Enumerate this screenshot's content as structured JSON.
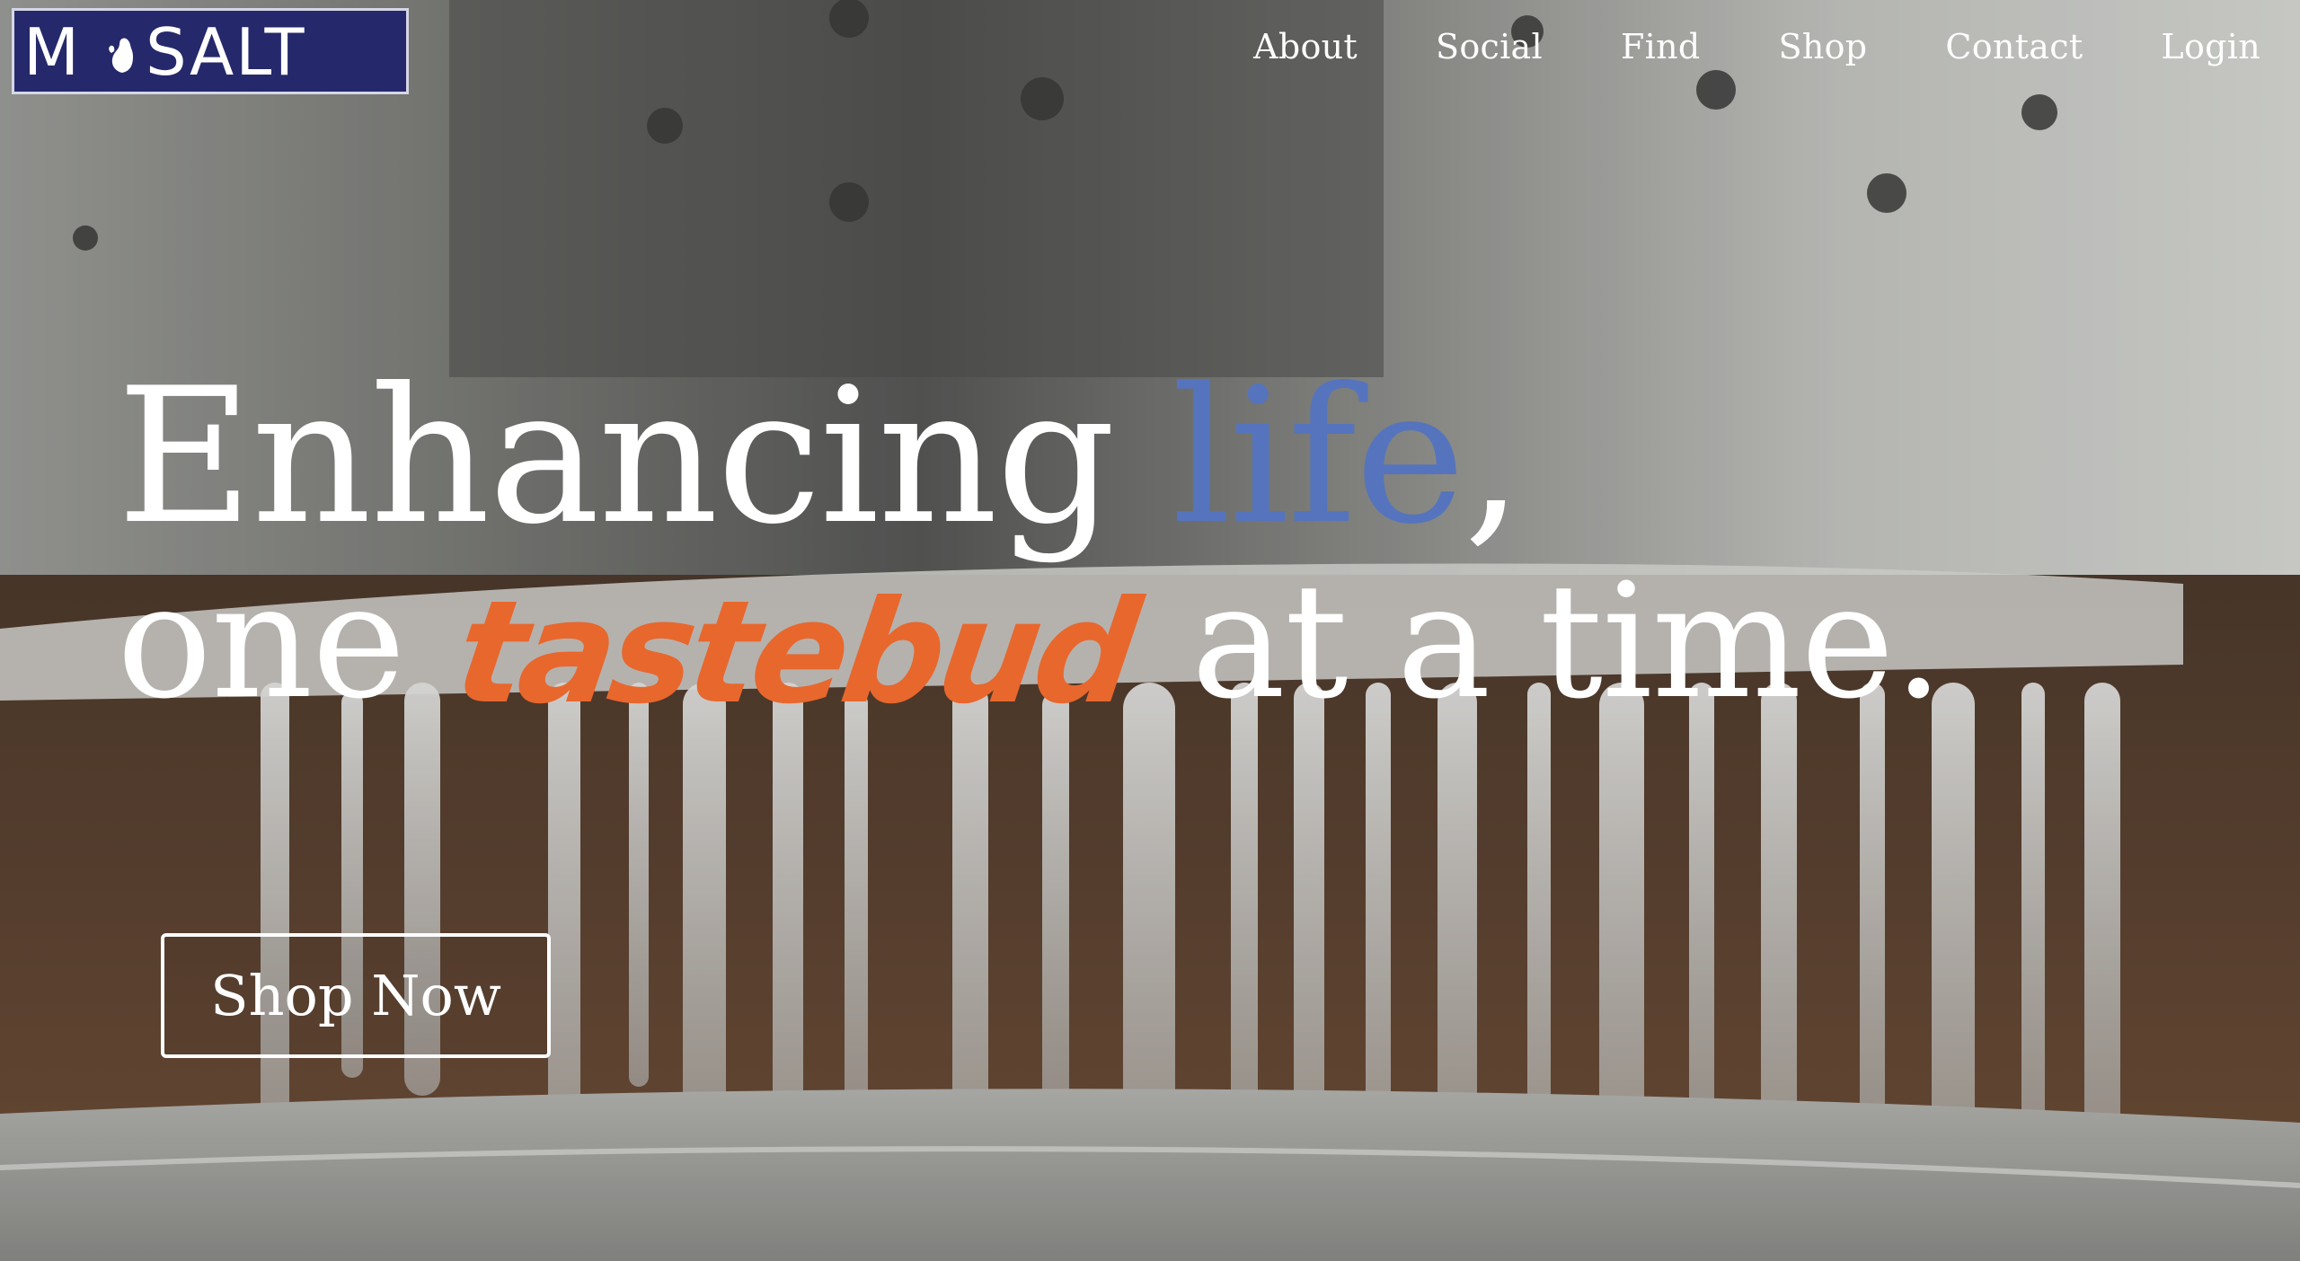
{
  "brand": {
    "logo_text": "M SALT",
    "logo_letter_left": "M",
    "logo_letter_right": "SALT",
    "logo_icon": "michigan-mitten-icon",
    "logo_bg": "#25296b",
    "logo_fg": "#ffffff"
  },
  "nav": {
    "items": [
      {
        "label": "About"
      },
      {
        "label": "Social"
      },
      {
        "label": "Find"
      },
      {
        "label": "Shop"
      },
      {
        "label": "Contact"
      },
      {
        "label": "Login"
      }
    ]
  },
  "hero": {
    "line1_part1": "Enhancing",
    "line1_accent": "life",
    "line1_end": ",",
    "line2_start": "one",
    "line2_accent": "tastebud",
    "line2_end": "at a time.",
    "accent_blue": "#5574bd",
    "accent_orange": "#e8672d",
    "cta_label": "Shop Now",
    "background": "salt-brine-dripping-video"
  }
}
